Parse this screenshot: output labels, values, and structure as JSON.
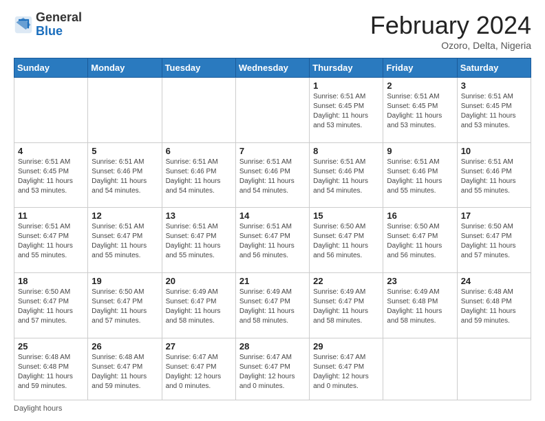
{
  "header": {
    "logo_general": "General",
    "logo_blue": "Blue",
    "month_title": "February 2024",
    "subtitle": "Ozoro, Delta, Nigeria"
  },
  "days_of_week": [
    "Sunday",
    "Monday",
    "Tuesday",
    "Wednesday",
    "Thursday",
    "Friday",
    "Saturday"
  ],
  "weeks": [
    [
      {
        "day": "",
        "info": ""
      },
      {
        "day": "",
        "info": ""
      },
      {
        "day": "",
        "info": ""
      },
      {
        "day": "",
        "info": ""
      },
      {
        "day": "1",
        "info": "Sunrise: 6:51 AM\nSunset: 6:45 PM\nDaylight: 11 hours and 53 minutes."
      },
      {
        "day": "2",
        "info": "Sunrise: 6:51 AM\nSunset: 6:45 PM\nDaylight: 11 hours and 53 minutes."
      },
      {
        "day": "3",
        "info": "Sunrise: 6:51 AM\nSunset: 6:45 PM\nDaylight: 11 hours and 53 minutes."
      }
    ],
    [
      {
        "day": "4",
        "info": "Sunrise: 6:51 AM\nSunset: 6:45 PM\nDaylight: 11 hours and 53 minutes."
      },
      {
        "day": "5",
        "info": "Sunrise: 6:51 AM\nSunset: 6:46 PM\nDaylight: 11 hours and 54 minutes."
      },
      {
        "day": "6",
        "info": "Sunrise: 6:51 AM\nSunset: 6:46 PM\nDaylight: 11 hours and 54 minutes."
      },
      {
        "day": "7",
        "info": "Sunrise: 6:51 AM\nSunset: 6:46 PM\nDaylight: 11 hours and 54 minutes."
      },
      {
        "day": "8",
        "info": "Sunrise: 6:51 AM\nSunset: 6:46 PM\nDaylight: 11 hours and 54 minutes."
      },
      {
        "day": "9",
        "info": "Sunrise: 6:51 AM\nSunset: 6:46 PM\nDaylight: 11 hours and 55 minutes."
      },
      {
        "day": "10",
        "info": "Sunrise: 6:51 AM\nSunset: 6:46 PM\nDaylight: 11 hours and 55 minutes."
      }
    ],
    [
      {
        "day": "11",
        "info": "Sunrise: 6:51 AM\nSunset: 6:47 PM\nDaylight: 11 hours and 55 minutes."
      },
      {
        "day": "12",
        "info": "Sunrise: 6:51 AM\nSunset: 6:47 PM\nDaylight: 11 hours and 55 minutes."
      },
      {
        "day": "13",
        "info": "Sunrise: 6:51 AM\nSunset: 6:47 PM\nDaylight: 11 hours and 55 minutes."
      },
      {
        "day": "14",
        "info": "Sunrise: 6:51 AM\nSunset: 6:47 PM\nDaylight: 11 hours and 56 minutes."
      },
      {
        "day": "15",
        "info": "Sunrise: 6:50 AM\nSunset: 6:47 PM\nDaylight: 11 hours and 56 minutes."
      },
      {
        "day": "16",
        "info": "Sunrise: 6:50 AM\nSunset: 6:47 PM\nDaylight: 11 hours and 56 minutes."
      },
      {
        "day": "17",
        "info": "Sunrise: 6:50 AM\nSunset: 6:47 PM\nDaylight: 11 hours and 57 minutes."
      }
    ],
    [
      {
        "day": "18",
        "info": "Sunrise: 6:50 AM\nSunset: 6:47 PM\nDaylight: 11 hours and 57 minutes."
      },
      {
        "day": "19",
        "info": "Sunrise: 6:50 AM\nSunset: 6:47 PM\nDaylight: 11 hours and 57 minutes."
      },
      {
        "day": "20",
        "info": "Sunrise: 6:49 AM\nSunset: 6:47 PM\nDaylight: 11 hours and 58 minutes."
      },
      {
        "day": "21",
        "info": "Sunrise: 6:49 AM\nSunset: 6:47 PM\nDaylight: 11 hours and 58 minutes."
      },
      {
        "day": "22",
        "info": "Sunrise: 6:49 AM\nSunset: 6:47 PM\nDaylight: 11 hours and 58 minutes."
      },
      {
        "day": "23",
        "info": "Sunrise: 6:49 AM\nSunset: 6:48 PM\nDaylight: 11 hours and 58 minutes."
      },
      {
        "day": "24",
        "info": "Sunrise: 6:48 AM\nSunset: 6:48 PM\nDaylight: 11 hours and 59 minutes."
      }
    ],
    [
      {
        "day": "25",
        "info": "Sunrise: 6:48 AM\nSunset: 6:48 PM\nDaylight: 11 hours and 59 minutes."
      },
      {
        "day": "26",
        "info": "Sunrise: 6:48 AM\nSunset: 6:47 PM\nDaylight: 11 hours and 59 minutes."
      },
      {
        "day": "27",
        "info": "Sunrise: 6:47 AM\nSunset: 6:47 PM\nDaylight: 12 hours and 0 minutes."
      },
      {
        "day": "28",
        "info": "Sunrise: 6:47 AM\nSunset: 6:47 PM\nDaylight: 12 hours and 0 minutes."
      },
      {
        "day": "29",
        "info": "Sunrise: 6:47 AM\nSunset: 6:47 PM\nDaylight: 12 hours and 0 minutes."
      },
      {
        "day": "",
        "info": ""
      },
      {
        "day": "",
        "info": ""
      }
    ]
  ],
  "footer": "Daylight hours"
}
